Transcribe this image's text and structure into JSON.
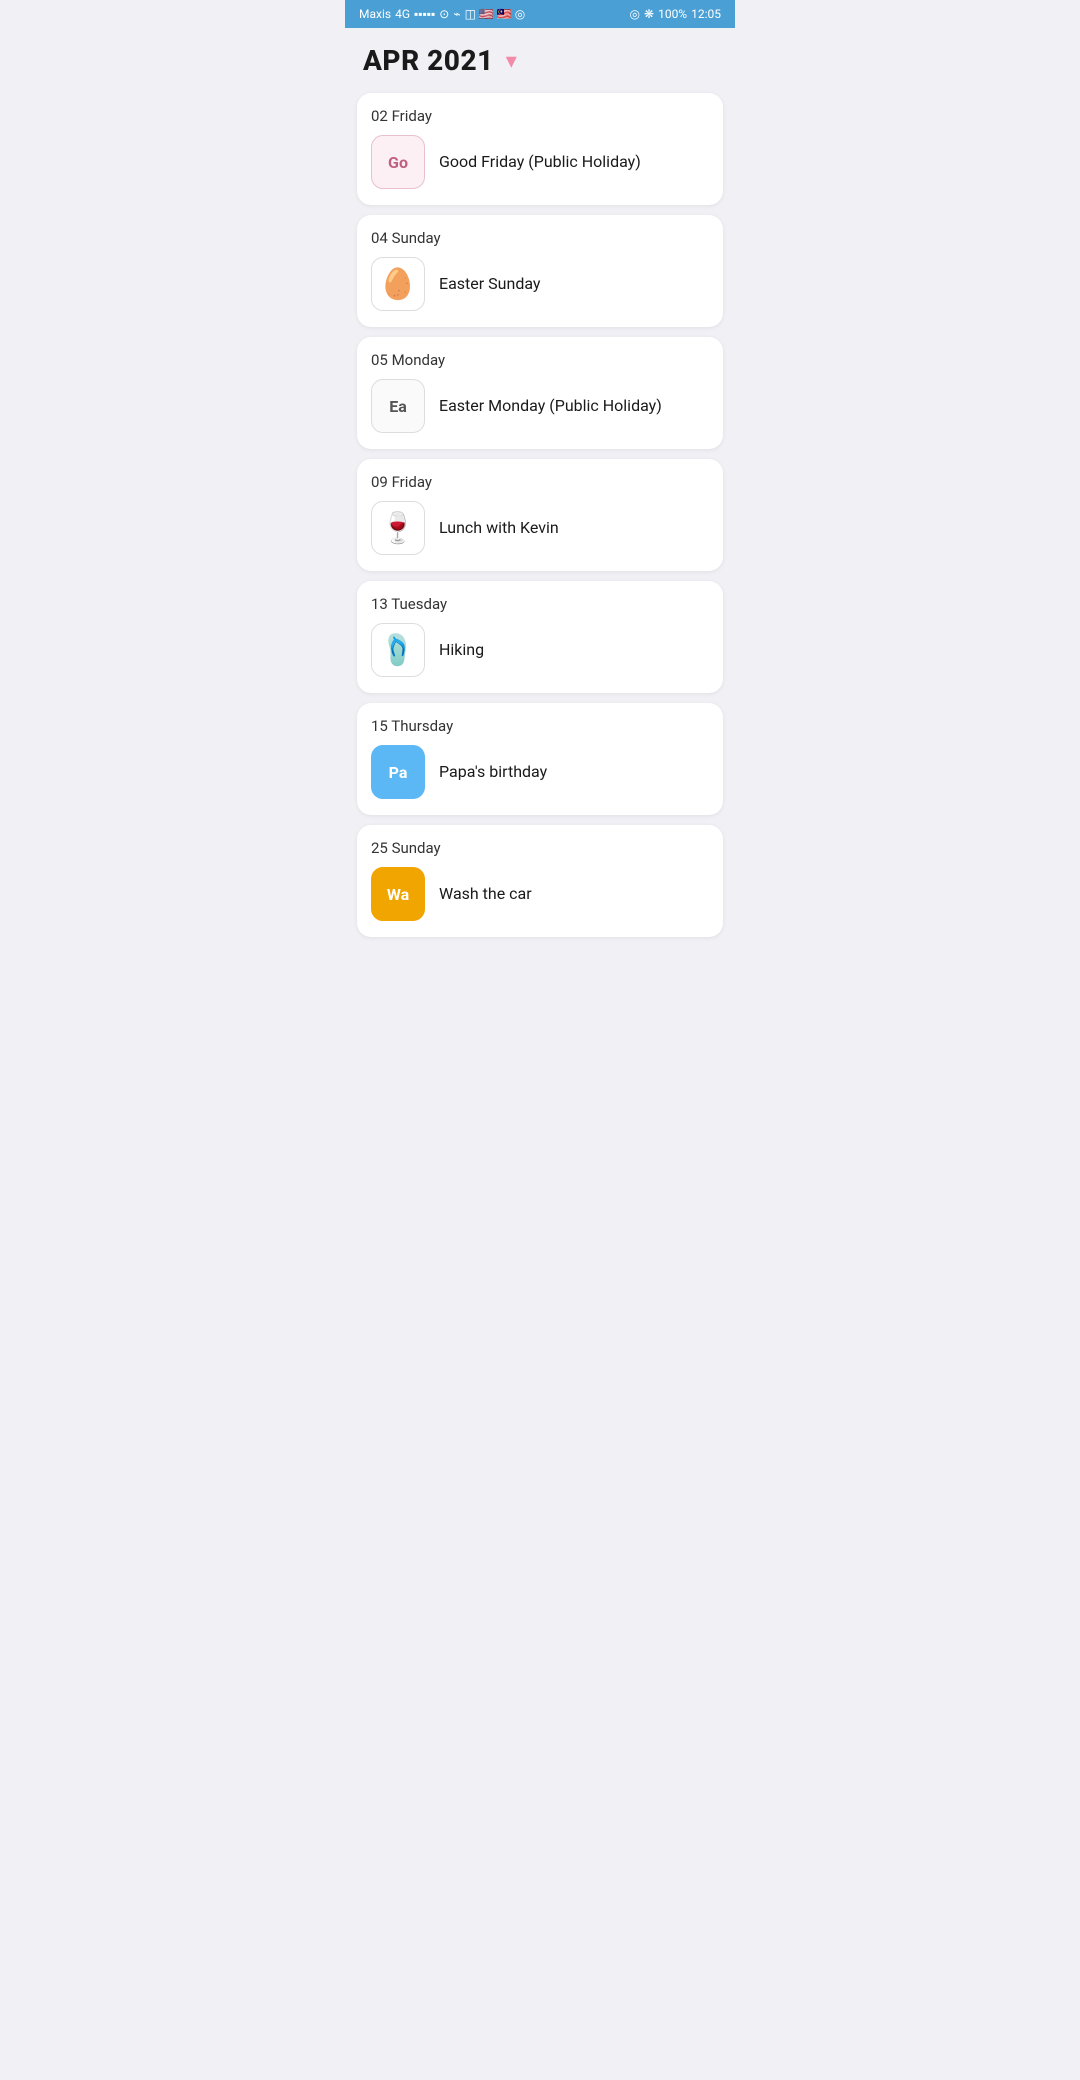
{
  "statusBar": {
    "carrier": "Maxis",
    "signal": "4G",
    "battery": "100%",
    "time": "12:05"
  },
  "header": {
    "title": "APR 2021",
    "chevron": "▾"
  },
  "events": [
    {
      "id": "ev1",
      "date": "02 Friday",
      "title": "Good Friday (Public Holiday)",
      "iconType": "initials",
      "iconStyle": "pink-border",
      "iconText": "Go",
      "emoji": ""
    },
    {
      "id": "ev2",
      "date": "04 Sunday",
      "title": "Easter Sunday",
      "iconType": "emoji",
      "iconStyle": "",
      "iconText": "",
      "emoji": "🥚"
    },
    {
      "id": "ev3",
      "date": "05 Monday",
      "title": "Easter Monday (Public Holiday)",
      "iconType": "initials",
      "iconStyle": "ea-border",
      "iconText": "Ea",
      "emoji": ""
    },
    {
      "id": "ev4",
      "date": "09 Friday",
      "title": "Lunch with Kevin",
      "iconType": "emoji",
      "iconStyle": "",
      "iconText": "",
      "emoji": "🍷"
    },
    {
      "id": "ev5",
      "date": "13 Tuesday",
      "title": "Hiking",
      "iconType": "emoji",
      "iconStyle": "",
      "iconText": "",
      "emoji": "🩴"
    },
    {
      "id": "ev6",
      "date": "15 Thursday",
      "title": "Papa's birthday",
      "iconType": "initials",
      "iconStyle": "blue-bg",
      "iconText": "Pa",
      "emoji": ""
    },
    {
      "id": "ev7",
      "date": "25 Sunday",
      "title": "Wash the car",
      "iconType": "initials",
      "iconStyle": "yellow-bg",
      "iconText": "Wa",
      "emoji": ""
    }
  ]
}
